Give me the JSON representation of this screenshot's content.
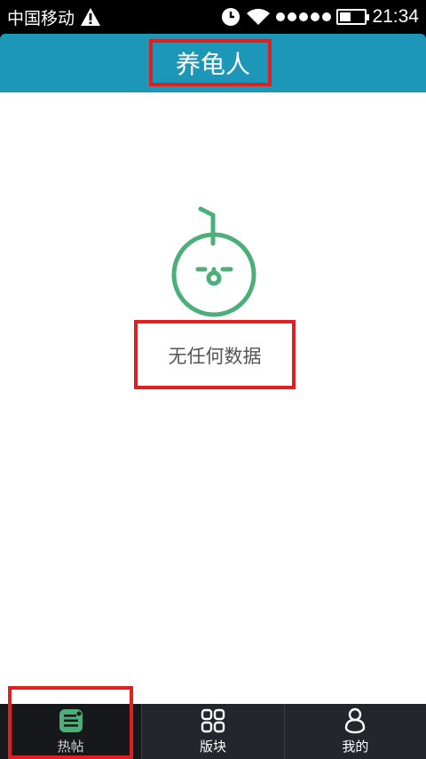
{
  "status_bar": {
    "carrier": "中国移动",
    "time": "21:34",
    "battery_level": 0.45,
    "signal_dots": 5,
    "icons": [
      "warning-icon",
      "alarm-icon",
      "wifi-icon",
      "signal-icon",
      "battery-icon"
    ]
  },
  "header": {
    "title": "养龟人",
    "color": "#1c97b8"
  },
  "empty_state": {
    "icon": "empty-face-icon",
    "message": "无任何数据",
    "accent": "#4caf7a"
  },
  "bottom_nav": {
    "items": [
      {
        "label": "热帖",
        "icon": "posts-icon",
        "active": true
      },
      {
        "label": "版块",
        "icon": "grid-icon",
        "active": false
      },
      {
        "label": "我的",
        "icon": "profile-icon",
        "active": false
      }
    ]
  },
  "highlight_color": "#e02020"
}
